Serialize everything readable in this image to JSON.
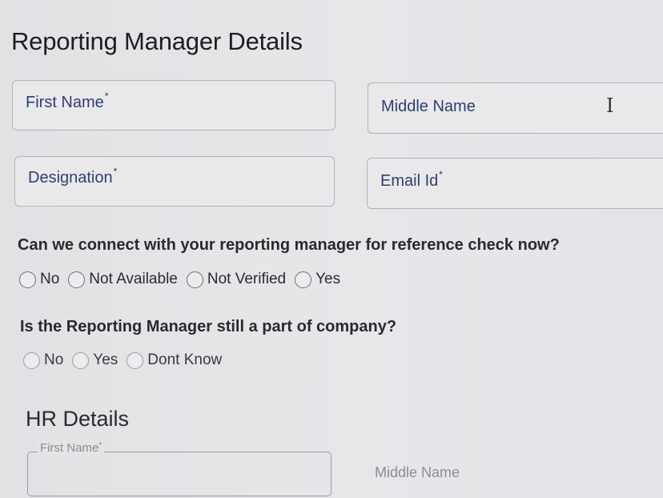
{
  "reporting_manager": {
    "title": "Reporting Manager Details",
    "fields": {
      "first_name": {
        "label": "First Name",
        "required_mark": "*"
      },
      "middle_name": {
        "label": "Middle Name"
      },
      "designation": {
        "label": "Designation",
        "required_mark": "*"
      },
      "email": {
        "label": "Email Id",
        "required_mark": "*"
      }
    },
    "question_reference": {
      "text": "Can we connect with your reporting manager for reference check now?",
      "options": [
        "No",
        "Not Available",
        "Not Verified",
        "Yes"
      ]
    },
    "question_company": {
      "text": "Is the Reporting Manager still a part of company?",
      "options": [
        "No",
        "Yes",
        "Dont Know"
      ]
    }
  },
  "hr_details": {
    "title": "HR Details",
    "fields": {
      "first_name": {
        "label": "First Name",
        "required_mark": "*"
      },
      "middle_name": {
        "label": "Middle Name"
      }
    }
  },
  "icons": {
    "text_cursor": "text-cursor-icon"
  },
  "colors": {
    "field_label": "#2e3f6e",
    "background": "#e6e6e9"
  }
}
